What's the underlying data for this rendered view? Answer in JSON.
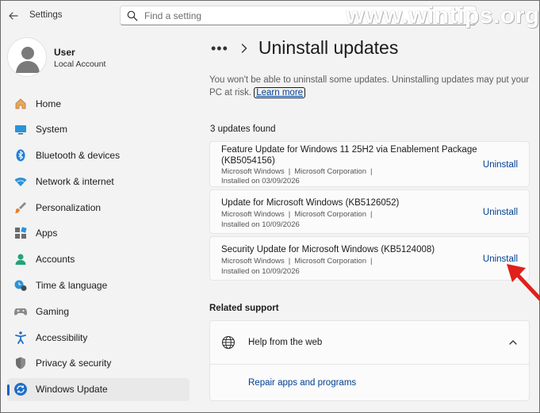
{
  "window": {
    "title": "Settings"
  },
  "search": {
    "placeholder": "Find a setting"
  },
  "watermark": "www.wintips.org",
  "profile": {
    "name": "User",
    "account_type": "Local Account"
  },
  "nav": {
    "items": [
      {
        "label": "Home",
        "icon": "home-icon"
      },
      {
        "label": "System",
        "icon": "system-icon"
      },
      {
        "label": "Bluetooth & devices",
        "icon": "bluetooth-icon"
      },
      {
        "label": "Network & internet",
        "icon": "wifi-icon"
      },
      {
        "label": "Personalization",
        "icon": "brush-icon"
      },
      {
        "label": "Apps",
        "icon": "apps-icon"
      },
      {
        "label": "Accounts",
        "icon": "accounts-icon"
      },
      {
        "label": "Time & language",
        "icon": "clock-icon"
      },
      {
        "label": "Gaming",
        "icon": "gamepad-icon"
      },
      {
        "label": "Accessibility",
        "icon": "accessibility-icon"
      },
      {
        "label": "Privacy & security",
        "icon": "shield-icon"
      },
      {
        "label": "Windows Update",
        "icon": "windows-update-icon"
      }
    ],
    "active_index": 11
  },
  "breadcrumb": {
    "dots": "•••",
    "page_title": "Uninstall updates"
  },
  "warning": {
    "text": "You won't be able to uninstall some updates. Uninstalling updates may put your PC at risk.",
    "learn_more": "Learn more"
  },
  "updates": {
    "count_label": "3 updates found",
    "items": [
      {
        "title": "Feature Update for Windows 11 25H2 via Enablement Package (KB5054156)",
        "product": "Microsoft Windows",
        "publisher": "Microsoft Corporation",
        "installed": "Installed on 03/09/2026",
        "action": "Uninstall"
      },
      {
        "title": "Update for Microsoft Windows (KB5126052)",
        "product": "Microsoft Windows",
        "publisher": "Microsoft Corporation",
        "installed": "Installed on 10/09/2026",
        "action": "Uninstall"
      },
      {
        "title": "Security Update for Microsoft Windows (KB5124008)",
        "product": "Microsoft Windows",
        "publisher": "Microsoft Corporation",
        "installed": "Installed on 10/09/2026",
        "action": "Uninstall"
      }
    ],
    "separator": "|"
  },
  "related": {
    "title": "Related support",
    "section_label": "Help from the web",
    "link": "Repair apps and programs"
  },
  "colors": {
    "accent": "#0067c0",
    "link": "#003e92",
    "arrow": "#e0201b"
  }
}
